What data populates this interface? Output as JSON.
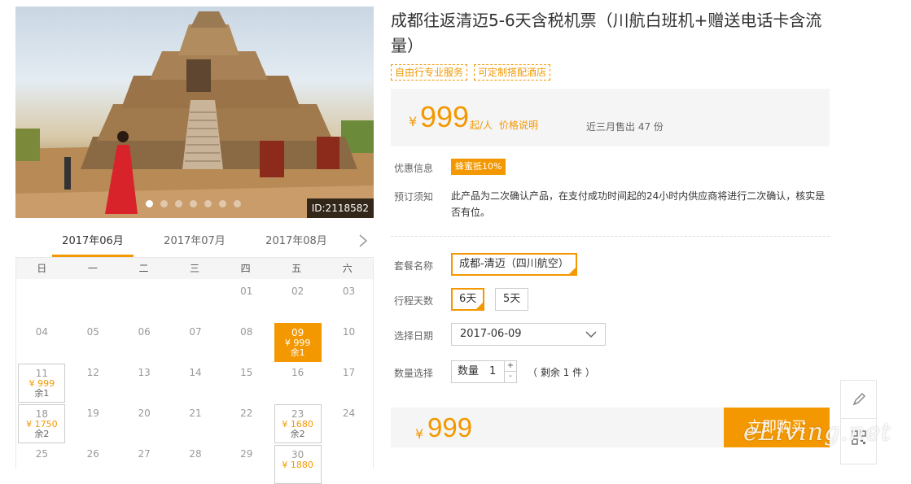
{
  "hero": {
    "image_id": "ID:2118582",
    "slide_count": 7,
    "active_slide": 1
  },
  "calendar": {
    "months": [
      "2017年06月",
      "2017年07月",
      "2017年08月"
    ],
    "weekdays": [
      "日",
      "一",
      "二",
      "三",
      "四",
      "五",
      "六"
    ],
    "rows": [
      [
        null,
        null,
        null,
        null,
        {
          "day": "01"
        },
        {
          "day": "02"
        },
        {
          "day": "03"
        }
      ],
      [
        {
          "day": "04"
        },
        {
          "day": "05"
        },
        {
          "day": "06"
        },
        {
          "day": "07"
        },
        {
          "day": "08"
        },
        {
          "day": "09",
          "price": "¥ 999",
          "remain": "余1",
          "selected": true
        },
        {
          "day": "10"
        }
      ],
      [
        {
          "day": "11",
          "price": "¥ 999",
          "remain": "余1"
        },
        {
          "day": "12"
        },
        {
          "day": "13"
        },
        {
          "day": "14"
        },
        {
          "day": "15"
        },
        {
          "day": "16"
        },
        {
          "day": "17"
        }
      ],
      [
        {
          "day": "18",
          "price": "¥ 1750",
          "remain": "余2"
        },
        {
          "day": "19"
        },
        {
          "day": "20"
        },
        {
          "day": "21"
        },
        {
          "day": "22"
        },
        {
          "day": "23",
          "price": "¥ 1680",
          "remain": "余2"
        },
        {
          "day": "24"
        }
      ],
      [
        {
          "day": "25"
        },
        {
          "day": "26"
        },
        {
          "day": "27"
        },
        {
          "day": "28"
        },
        {
          "day": "29"
        },
        {
          "day": "30",
          "price": "¥ 1880",
          "remain": ""
        },
        null
      ]
    ]
  },
  "product": {
    "title": "成都往返清迈5-6天含税机票（川航白班机+赠送电话卡含流量）",
    "tags": [
      "自由行专业服务",
      "可定制搭配酒店"
    ],
    "price_symbol": "¥",
    "price": "999",
    "price_unit": "起/人",
    "price_note_link": "价格说明",
    "sold": "近三月售出 47 份"
  },
  "info": {
    "discount_label": "优惠信息",
    "discount_badge": "蜂蜜抵10%",
    "notice_label": "预订须知",
    "notice_text": "此产品为二次确认产品，在支付成功时间起的24小时内供应商将进行二次确认，核实是否有位。"
  },
  "options": {
    "package_label": "套餐名称",
    "package_value": "成都-清迈（四川航空）",
    "days_label": "行程天数",
    "days": [
      "6天",
      "5天"
    ],
    "date_label": "选择日期",
    "date_value": "2017-06-09",
    "qty_label": "数量选择",
    "qty_inner_label": "数量",
    "qty_value": "1",
    "qty_up": "+",
    "qty_down": "-",
    "stock": "（ 剩余 1 件 ）"
  },
  "order": {
    "price_symbol": "¥",
    "total": "999",
    "buy_button": "立即购买"
  },
  "watermark": "eLiving.net",
  "colors": {
    "accent": "#f39800",
    "panel": "#f5f5f5"
  }
}
